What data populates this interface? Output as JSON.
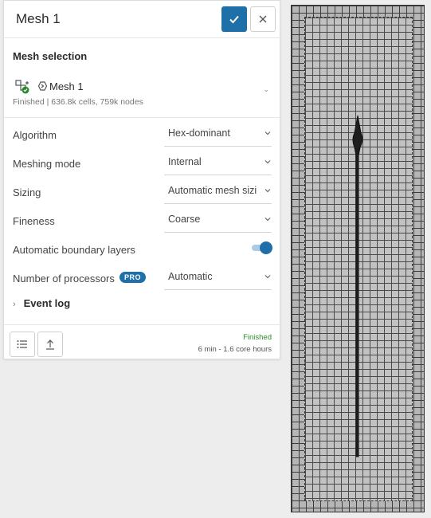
{
  "header": {
    "title": "Mesh 1"
  },
  "mesh_selection": {
    "title": "Mesh selection",
    "item_name": "Mesh 1",
    "item_status": "Finished | 636.8k cells, 759k nodes"
  },
  "settings": [
    {
      "label": "Algorithm",
      "value": "Hex-dominant"
    },
    {
      "label": "Meshing mode",
      "value": "Internal"
    },
    {
      "label": "Sizing",
      "value": "Automatic mesh sizi"
    },
    {
      "label": "Fineness",
      "value": "Coarse"
    }
  ],
  "boundary_layers": {
    "label": "Automatic boundary layers",
    "enabled": true
  },
  "processors": {
    "label": "Number of processors",
    "badge": "PRO",
    "value": "Automatic"
  },
  "event_log": {
    "label": "Event log"
  },
  "footer": {
    "status": "Finished",
    "time": "6 min - 1.6 core hours"
  },
  "colors": {
    "accent": "#1f6fa8",
    "success": "#2a8a2a"
  },
  "icons": {
    "confirm": "check-icon",
    "close": "close-icon",
    "list": "list-icon",
    "export": "upload-icon"
  }
}
